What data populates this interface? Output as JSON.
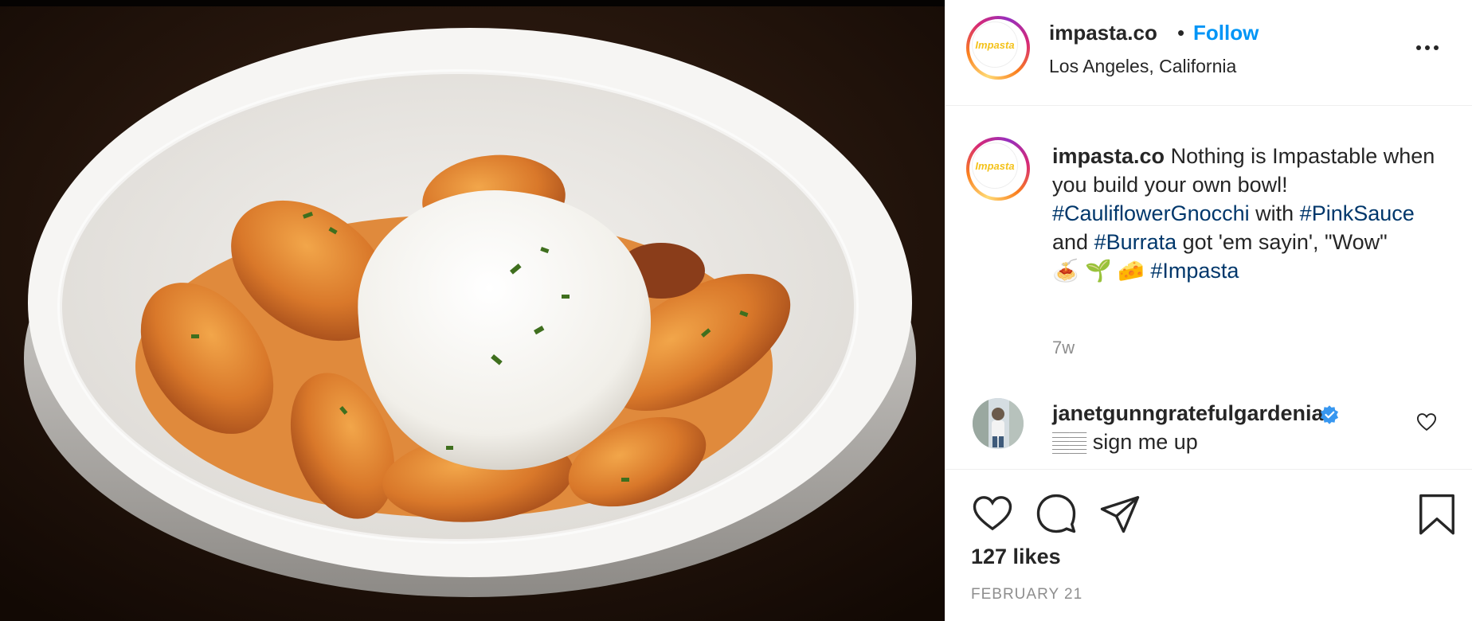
{
  "post": {
    "photo_alt": "",
    "header": {
      "avatar_text": "Impasta",
      "username": "impasta.co",
      "separator": "•",
      "follow_label": "Follow",
      "location": "Los Angeles, California"
    },
    "caption": {
      "avatar_text": "Impasta",
      "username": "impasta.co",
      "text_1": "Nothing is Impastable when you build your own bowl!",
      "tag_1": "#CauliflowerGnocchi",
      "text_2": "with",
      "tag_2": "#PinkSauce",
      "text_3": "and",
      "tag_3": "#Burrata",
      "text_4": "got 'em sayin', \"Wow\"",
      "emojis": "🍝 🌱 🧀",
      "tag_4": "#Impasta",
      "time": "7w"
    },
    "comment": {
      "username": "janetgunngratefulgardenia",
      "text": "𝄛𝄛 sign me up"
    },
    "actions": {
      "likes": "127 likes",
      "date": "FEBRUARY 21"
    },
    "colors": {
      "link_blue": "#0095f6",
      "hashtag": "#00376b",
      "muted": "#8e8e8e",
      "verified": "#3897f0"
    },
    "icons": [
      "heart-icon",
      "comment-icon",
      "share-icon",
      "bookmark-icon",
      "more-icon",
      "verified-badge-icon"
    ]
  }
}
